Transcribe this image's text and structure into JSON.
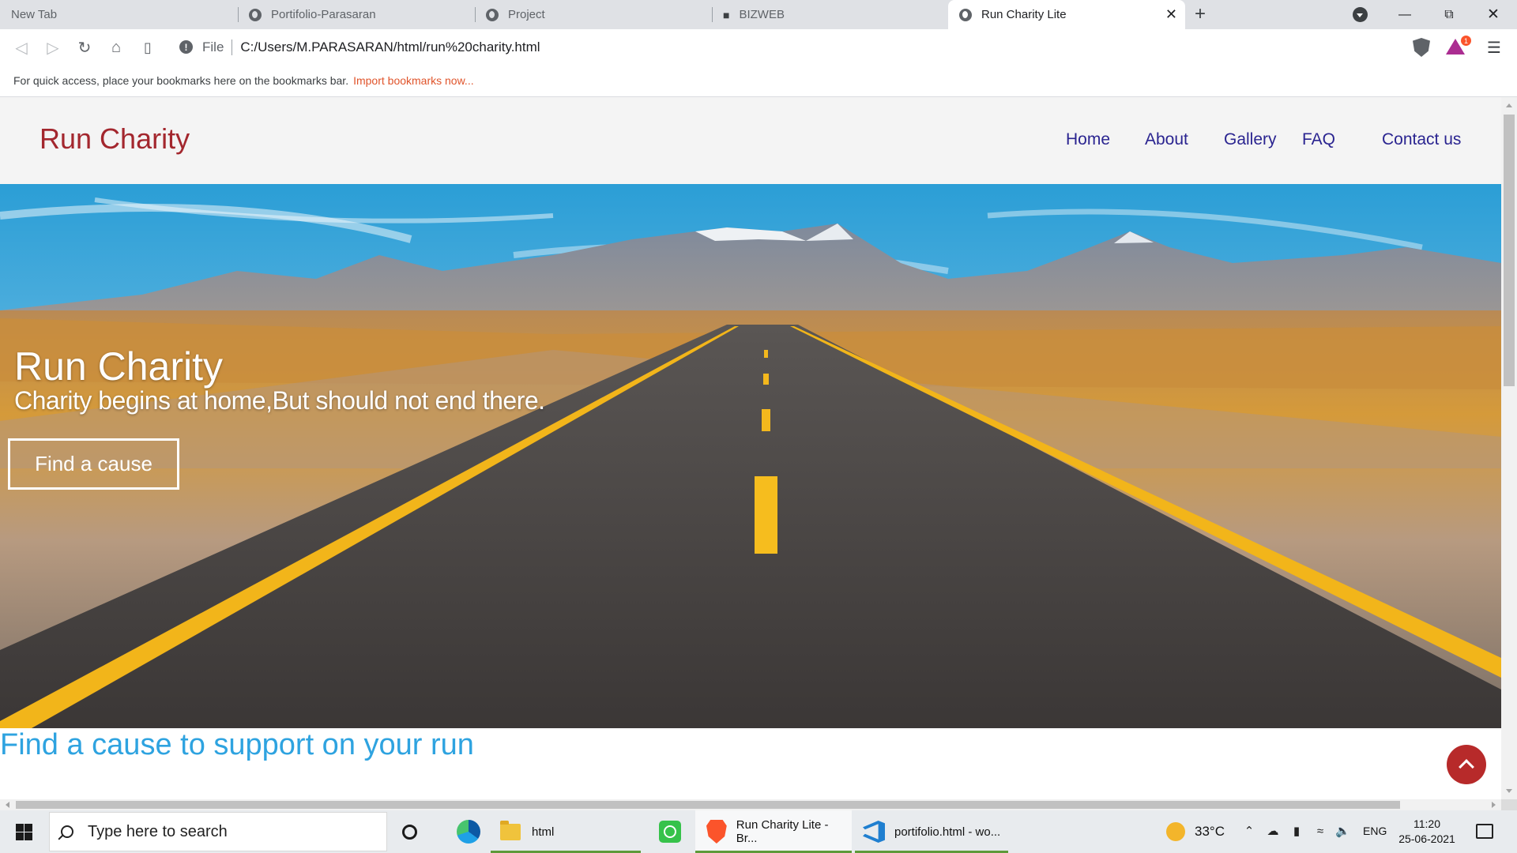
{
  "browser": {
    "tabs": [
      {
        "label": "New Tab"
      },
      {
        "label": "Portifolio-Parasaran"
      },
      {
        "label": "Project"
      },
      {
        "label": "BIZWEB"
      },
      {
        "label": "Run Charity Lite",
        "active": true
      }
    ],
    "address": {
      "scheme": "File",
      "url": "C:/Users/M.PARASARAN/html/run%20charity.html"
    },
    "rewards_badge": "1",
    "bookmarks_bar": {
      "message": "For quick access, place your bookmarks here on the bookmarks bar.",
      "import_link": "Import bookmarks now..."
    }
  },
  "site": {
    "brand": "Run Charity",
    "nav": [
      "Home",
      "About",
      "Gallery",
      "FAQ",
      "Contact us"
    ],
    "hero": {
      "title": "Run Charity",
      "subtitle": "Charity begins at home,But should not end there.",
      "button": "Find a cause"
    },
    "section_title": "Find a cause to support on your run",
    "colors": {
      "brand": "#a3272e",
      "nav": "#2a2490",
      "section_title": "#2ea3e0",
      "scroll_top": "#b72a2a"
    }
  },
  "taskbar": {
    "search_placeholder": "Type here to search",
    "items": [
      {
        "label": "html",
        "icon": "folder-icon"
      },
      {
        "label": "Run Charity Lite - Br...",
        "icon": "brave-icon"
      },
      {
        "label": "portifolio.html - wo...",
        "icon": "vscode-icon"
      }
    ],
    "weather": "33°C",
    "language": "ENG",
    "time": "11:20",
    "date": "25-06-2021"
  }
}
